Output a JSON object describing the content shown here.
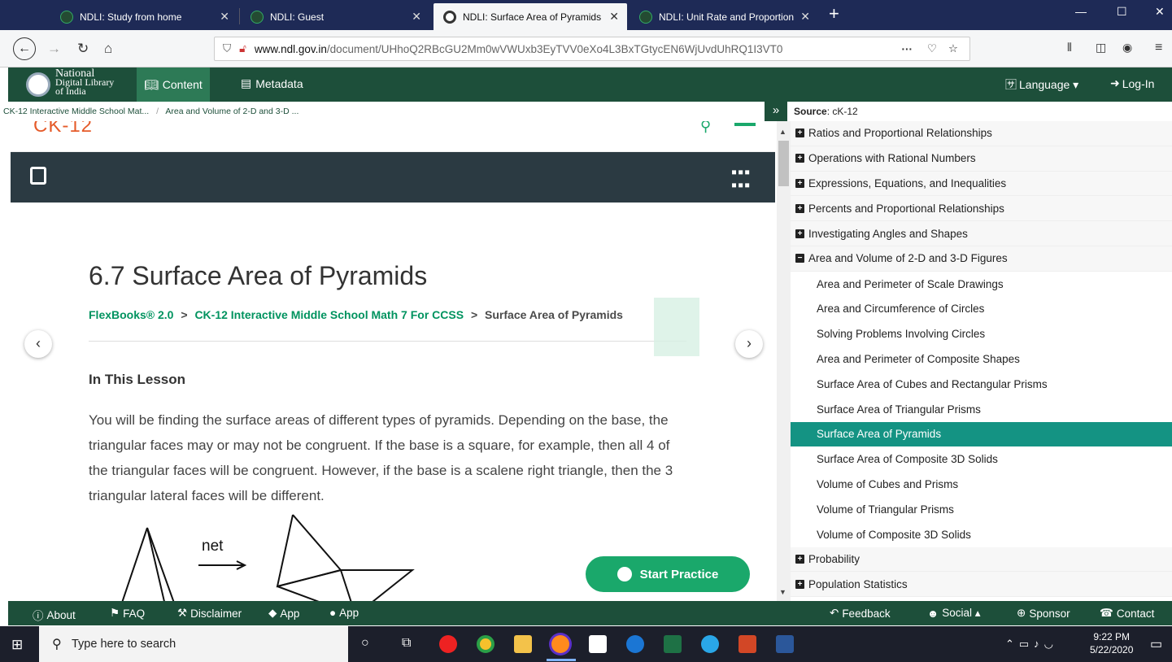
{
  "browser": {
    "tabs": [
      {
        "title": "NDLI: Study from home"
      },
      {
        "title": "NDLI: Guest"
      },
      {
        "title": "NDLI: Surface Area of Pyramids"
      },
      {
        "title": "NDLI: Unit Rate and Proportion"
      }
    ],
    "new_tab": "+",
    "url_domain": "www.ndl.gov.in",
    "url_path": "/document/UHhoQ2RBcGU2Mm0wVWUxb3EyTVV0eXo4L3BxTGtycEN6WjUvdUhRQ1I3VT0",
    "url_more": "···"
  },
  "ndl_nav": {
    "logo_line1": "National",
    "logo_line2": "Digital Library",
    "logo_line3": "of India",
    "content_label": "Content",
    "metadata_label": "Metadata",
    "language_label": "Language ▾",
    "login_label": "Log-In"
  },
  "breadcrumb": {
    "item1": "CK-12 Interactive Middle School Mat...",
    "sep": "/",
    "item2": "Area and Volume of 2-D and 3-D ..."
  },
  "lesson": {
    "brand": "CK-12",
    "title": "6.7 Surface Area of Pyramids",
    "crumb1": "FlexBooks® 2.0",
    "crumb2": "CK-12 Interactive Middle School Math 7 For CCSS",
    "crumb3": "Surface Area of Pyramids",
    "crumb_sep": ">",
    "section_heading": "In This Lesson",
    "body": "You will be finding the surface areas of different types of pyramids.  Depending on the base, the triangular faces may or may not be congruent.  If the base is a square, for example, then all 4 of the triangular faces will be congruent.  However, if the base is a scalene right triangle, then the 3 triangular lateral faces will be different.",
    "figure_label": "net",
    "start_practice": "Start Practice"
  },
  "sidebar": {
    "source_label": "Source",
    "source_value": ": cK-12",
    "items": [
      {
        "label": "Ratios and Proportional Relationships",
        "type": "collapsed"
      },
      {
        "label": "Operations with Rational Numbers",
        "type": "collapsed"
      },
      {
        "label": "Expressions, Equations, and Inequalities",
        "type": "collapsed"
      },
      {
        "label": "Percents and Proportional Relationships",
        "type": "collapsed"
      },
      {
        "label": "Investigating Angles and Shapes",
        "type": "collapsed"
      },
      {
        "label": "Area and Volume of 2-D and 3-D Figures",
        "type": "expanded"
      },
      {
        "label": "Area and Perimeter of Scale Drawings",
        "type": "sub"
      },
      {
        "label": "Area and Circumference of Circles",
        "type": "sub"
      },
      {
        "label": "Solving Problems Involving Circles",
        "type": "sub"
      },
      {
        "label": "Area and Perimeter of Composite Shapes",
        "type": "sub"
      },
      {
        "label": "Surface Area of Cubes and Rectangular Prisms",
        "type": "sub"
      },
      {
        "label": "Surface Area of Triangular Prisms",
        "type": "sub"
      },
      {
        "label": "Surface Area of Pyramids",
        "type": "selected"
      },
      {
        "label": "Surface Area of Composite 3D Solids",
        "type": "sub"
      },
      {
        "label": "Volume of Cubes and Prisms",
        "type": "sub"
      },
      {
        "label": "Volume of Triangular Prisms",
        "type": "sub"
      },
      {
        "label": "Volume of Composite 3D Solids",
        "type": "sub"
      },
      {
        "label": "Probability",
        "type": "collapsed"
      },
      {
        "label": "Population Statistics",
        "type": "collapsed"
      }
    ]
  },
  "footer": {
    "about": "About",
    "faq": "FAQ",
    "disclaimer": "Disclaimer",
    "app1": "App",
    "app2": "App",
    "feedback": "Feedback",
    "social": "Social ▴",
    "sponsor": "Sponsor",
    "contact": "Contact"
  },
  "taskbar": {
    "search_placeholder": "Type here to search",
    "time": "9:22 PM",
    "date": "5/22/2020"
  },
  "colors": {
    "ndl_green": "#1d4f3a",
    "ck12_green": "#00935f",
    "selected_teal": "#149383",
    "tab_bar": "#1e2a56"
  }
}
